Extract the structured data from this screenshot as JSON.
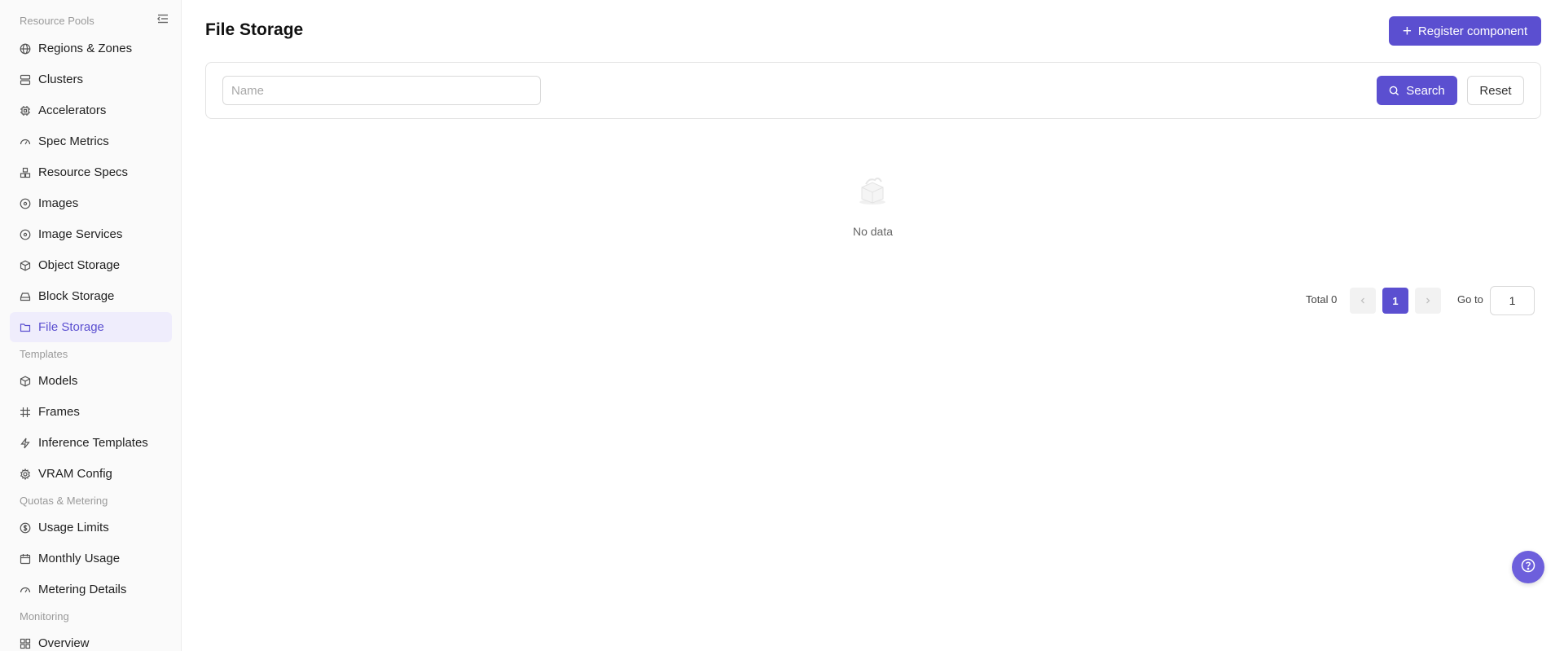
{
  "sidebar": {
    "groups": [
      {
        "label": "Resource Pools"
      },
      {
        "label": "Templates"
      },
      {
        "label": "Quotas & Metering"
      },
      {
        "label": "Monitoring"
      }
    ],
    "items": [
      {
        "label": "Regions & Zones",
        "icon": "globe-icon"
      },
      {
        "label": "Clusters",
        "icon": "server-icon"
      },
      {
        "label": "Accelerators",
        "icon": "chip-icon"
      },
      {
        "label": "Spec Metrics",
        "icon": "gauge-icon"
      },
      {
        "label": "Resource Specs",
        "icon": "boxes-icon"
      },
      {
        "label": "Images",
        "icon": "disc-icon"
      },
      {
        "label": "Image Services",
        "icon": "disc-icon"
      },
      {
        "label": "Object Storage",
        "icon": "package-icon"
      },
      {
        "label": "Block Storage",
        "icon": "hard-drive-icon"
      },
      {
        "label": "File Storage",
        "icon": "folder-icon",
        "active": true
      },
      {
        "label": "Models",
        "icon": "package-icon"
      },
      {
        "label": "Frames",
        "icon": "hash-icon"
      },
      {
        "label": "Inference Templates",
        "icon": "lightning-icon"
      },
      {
        "label": "VRAM Config",
        "icon": "gear-icon"
      },
      {
        "label": "Usage Limits",
        "icon": "coin-icon"
      },
      {
        "label": "Monthly Usage",
        "icon": "calendar-icon"
      },
      {
        "label": "Metering Details",
        "icon": "gauge-icon"
      },
      {
        "label": "Overview",
        "icon": "grid-icon"
      }
    ]
  },
  "header": {
    "title": "File Storage",
    "register_label": "Register component"
  },
  "filters": {
    "name_placeholder": "Name",
    "search_label": "Search",
    "reset_label": "Reset"
  },
  "empty": {
    "text": "No data"
  },
  "pagination": {
    "total_label": "Total 0",
    "current_page": "1",
    "goto_label": "Go to",
    "goto_value": "1"
  },
  "colors": {
    "accent": "#5b4fd0",
    "active_bg": "#efedfc"
  }
}
